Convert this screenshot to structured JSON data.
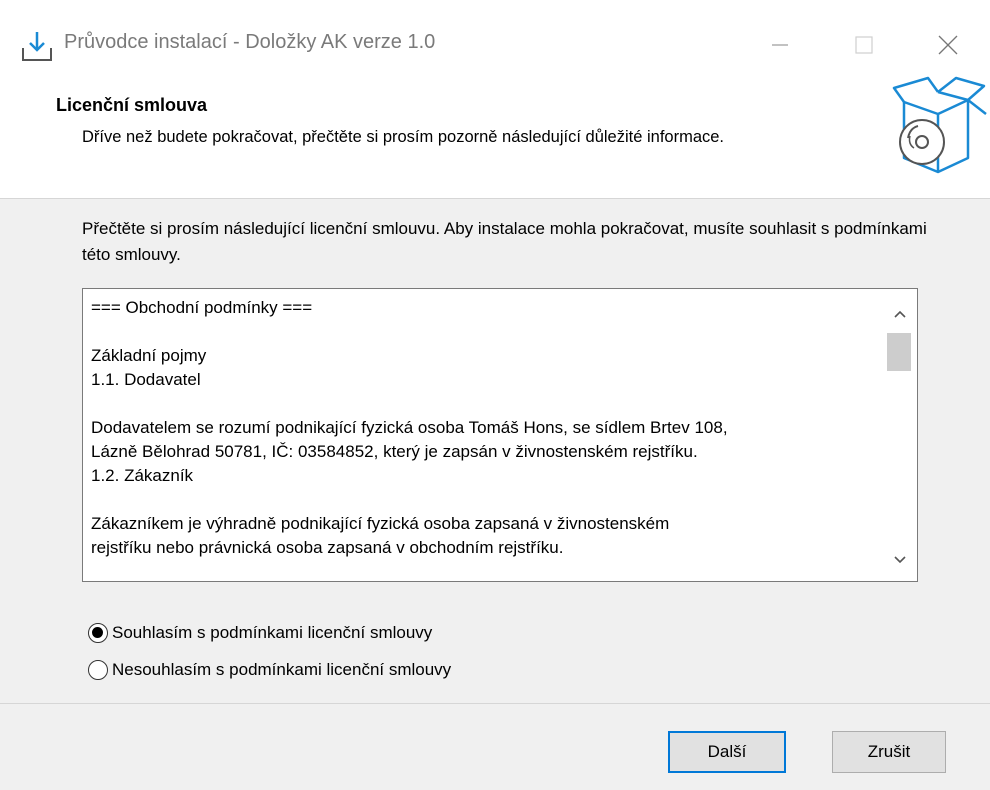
{
  "window": {
    "title": "Průvodce instalací - Doložky AK verze 1.0",
    "icons": [
      "installer-download-icon",
      "minimize-icon",
      "maximize-icon",
      "close-icon"
    ]
  },
  "header": {
    "title": "Licenční smlouva",
    "description": "Dříve než budete pokračovat, přečtěte si prosím pozorně následující důležité informace."
  },
  "intro": "Přečtěte si prosím následující licenční smlouvu. Aby instalace mohla pokračovat, musíte souhlasit s podmínkami této smlouvy.",
  "license": {
    "lines": [
      "=== Obchodní podmínky ===",
      "",
      "Základní pojmy",
      "1.1. Dodavatel",
      "",
      "Dodavatelem se rozumí podnikající fyzická osoba Tomáš Hons, se sídlem Brtev 108,",
      "Lázně Bělohrad 50781, IČ: 03584852, který je zapsán v živnostenském rejstříku.",
      "1.2. Zákazník",
      "",
      "Zákazníkem je výhradně podnikající fyzická osoba zapsaná v živnostenském",
      "rejstříku nebo právnická osoba zapsaná v obchodním rejstříku."
    ]
  },
  "options": {
    "accept": "Souhlasím s podmínkami licenční smlouvy",
    "decline": "Nesouhlasím s podmínkami licenční smlouvy",
    "selected": "accept"
  },
  "buttons": {
    "next": "Další",
    "cancel": "Zrušit"
  },
  "colors": {
    "accent": "#0078d7",
    "box_icon": "#1a8ad4"
  }
}
